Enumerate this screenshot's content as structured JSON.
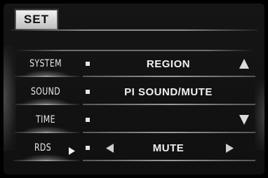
{
  "header": {
    "tab_label": "SET"
  },
  "rows": [
    {
      "label": "SYSTEM",
      "value": "REGION"
    },
    {
      "label": "SOUND",
      "value": "PI SOUND/MUTE"
    },
    {
      "label": "TIME",
      "value": ""
    },
    {
      "label": "RDS",
      "value": "MUTE"
    }
  ],
  "icons": {
    "scroll_up": "triangle-up-icon",
    "scroll_down": "triangle-down-icon",
    "rds_selector": "play-right-icon",
    "value_prev": "triangle-left-icon",
    "value_next": "triangle-right-icon",
    "bullet": "square-bullet-icon"
  },
  "colors": {
    "background": "#000000",
    "text": "#f0f0f0",
    "tab_background": "#dcdcdc",
    "divider": "#8a8a8a"
  }
}
